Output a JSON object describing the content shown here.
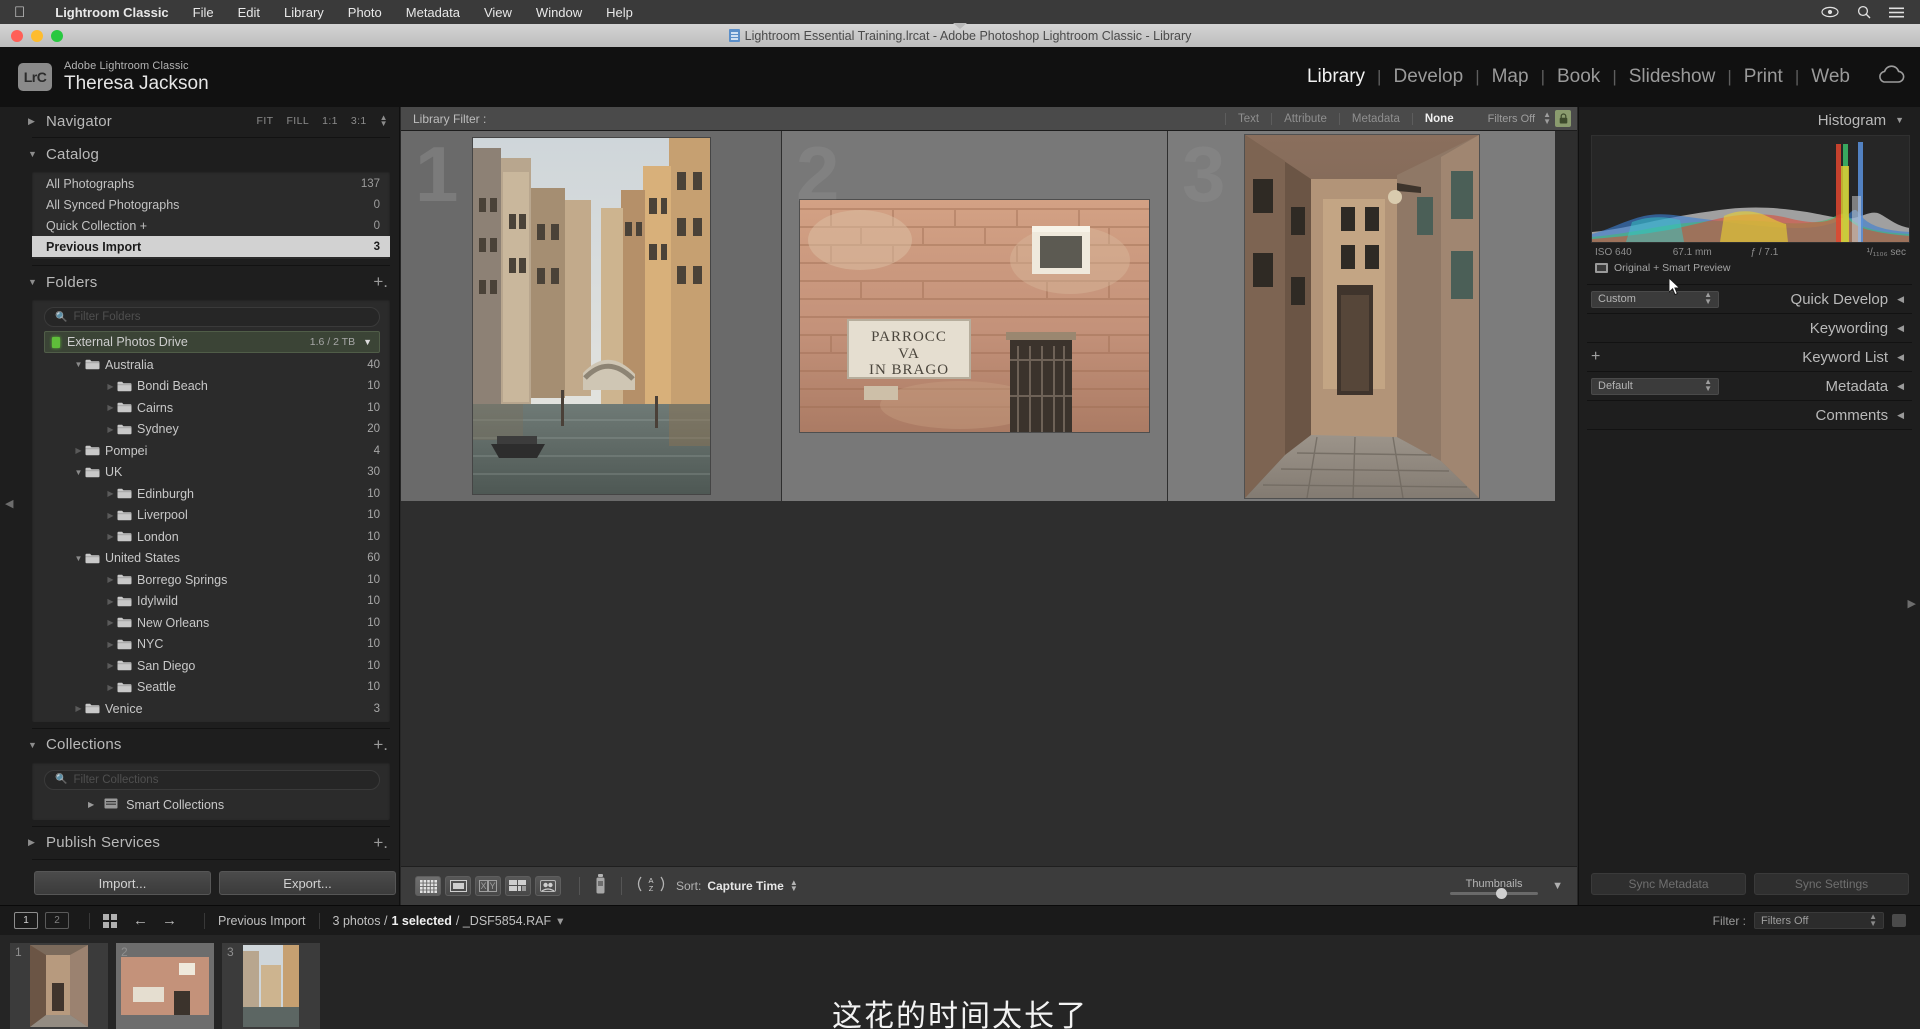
{
  "macmenu": {
    "apple_icon": "apple-icon",
    "items": [
      "Lightroom Classic",
      "File",
      "Edit",
      "Library",
      "Photo",
      "Metadata",
      "View",
      "Window",
      "Help"
    ],
    "right_icons": [
      "eye-icon",
      "search-icon",
      "control-center-icon"
    ]
  },
  "window": {
    "title": "Lightroom Essential Training.lrcat - Adobe Photoshop Lightroom Classic - Library",
    "doc_icon": "catalog-document-icon"
  },
  "identity": {
    "logo": "LrC",
    "product": "Adobe Lightroom Classic",
    "user": "Theresa Jackson",
    "cloud_icon": "cloud-sync-icon"
  },
  "modules": {
    "items": [
      "Library",
      "Develop",
      "Map",
      "Book",
      "Slideshow",
      "Print",
      "Web"
    ],
    "active": "Library",
    "separator": "|"
  },
  "navigator": {
    "title": "Navigator",
    "twisty": "▶",
    "zoom_options": [
      "FIT",
      "FILL",
      "1:1",
      "3:1"
    ],
    "stepper": "↕"
  },
  "catalog": {
    "title": "Catalog",
    "twisty": "▼",
    "items": [
      {
        "label": "All Photographs",
        "count": "137",
        "selected": false
      },
      {
        "label": "All Synced Photographs",
        "count": "0",
        "selected": false
      },
      {
        "label": "Quick Collection +",
        "count": "0",
        "selected": false
      },
      {
        "label": "Previous Import",
        "count": "3",
        "selected": true
      }
    ]
  },
  "folders": {
    "title": "Folders",
    "twisty": "▼",
    "add_icon": "plus-icon",
    "filter_placeholder": "Filter Folders",
    "drive": {
      "name": "External Photos Drive",
      "capacity": "1.6 / 2 TB",
      "led": "#5fbf3a"
    },
    "items": [
      {
        "label": "Australia",
        "count": "40",
        "level": 0,
        "expanded": true
      },
      {
        "label": "Bondi Beach",
        "count": "10",
        "level": 1,
        "expanded": false
      },
      {
        "label": "Cairns",
        "count": "10",
        "level": 1,
        "expanded": false
      },
      {
        "label": "Sydney",
        "count": "20",
        "level": 1,
        "expanded": false
      },
      {
        "label": "Pompei",
        "count": "4",
        "level": 0,
        "expanded": false
      },
      {
        "label": "UK",
        "count": "30",
        "level": 0,
        "expanded": true
      },
      {
        "label": "Edinburgh",
        "count": "10",
        "level": 1,
        "expanded": false
      },
      {
        "label": "Liverpool",
        "count": "10",
        "level": 1,
        "expanded": false
      },
      {
        "label": "London",
        "count": "10",
        "level": 1,
        "expanded": false
      },
      {
        "label": "United States",
        "count": "60",
        "level": 0,
        "expanded": true
      },
      {
        "label": "Borrego Springs",
        "count": "10",
        "level": 1,
        "expanded": false
      },
      {
        "label": "Idylwild",
        "count": "10",
        "level": 1,
        "expanded": false
      },
      {
        "label": "New Orleans",
        "count": "10",
        "level": 1,
        "expanded": false
      },
      {
        "label": "NYC",
        "count": "10",
        "level": 1,
        "expanded": false
      },
      {
        "label": "San Diego",
        "count": "10",
        "level": 1,
        "expanded": false
      },
      {
        "label": "Seattle",
        "count": "10",
        "level": 1,
        "expanded": false
      },
      {
        "label": "Venice",
        "count": "3",
        "level": 0,
        "expanded": false
      }
    ]
  },
  "collections": {
    "title": "Collections",
    "twisty": "▼",
    "add_icon": "plus-icon",
    "filter_placeholder": "Filter Collections",
    "items": [
      {
        "label": "Smart Collections",
        "twisty": "▶",
        "icon": "smart-collection-icon"
      }
    ]
  },
  "publish_services": {
    "title": "Publish Services",
    "twisty": "▶",
    "add_icon": "plus-icon"
  },
  "left_buttons": {
    "import": "Import...",
    "export": "Export..."
  },
  "library_filter": {
    "label": "Library Filter :",
    "options": [
      "Text",
      "Attribute",
      "Metadata",
      "None"
    ],
    "active": "None",
    "filters_off": "Filters Off",
    "stepper": "↕",
    "lock_icon": "lock-icon"
  },
  "grid": {
    "cells": [
      {
        "number": "1",
        "name": "venice-canal-photo",
        "selected": true
      },
      {
        "number": "2",
        "name": "brick-wall-sign-photo",
        "selected": false
      },
      {
        "number": "3",
        "name": "narrow-alley-photo",
        "selected": false
      }
    ]
  },
  "toolbar": {
    "view_buttons": [
      "grid-view-icon",
      "loupe-view-icon",
      "compare-view-icon",
      "survey-view-icon",
      "people-view-icon"
    ],
    "spray_icon": "spray-can-icon",
    "sort_direction_icon": "sort-az-icon",
    "sort_label": "Sort:",
    "sort_value": "Capture Time",
    "sort_stepper": "↕",
    "thumbnails_label": "Thumbnails",
    "collapse_icon": "chevron-down-icon"
  },
  "histogram": {
    "title": "Histogram",
    "caret": "▼",
    "iso": "ISO 640",
    "focal": "67.1 mm",
    "aperture": "ƒ / 7.1",
    "shutter": "¹/₁₁₀₆ sec",
    "preview_status": "Original + Smart Preview",
    "preview_icon": "smart-preview-icon"
  },
  "right_panels": [
    {
      "label": "Quick Develop",
      "caret": "◀",
      "select": "Custom",
      "has_select": true,
      "has_plus": false
    },
    {
      "label": "Keywording",
      "caret": "◀",
      "select": "",
      "has_select": false,
      "has_plus": false
    },
    {
      "label": "Keyword List",
      "caret": "◀",
      "select": "",
      "has_select": false,
      "has_plus": true
    },
    {
      "label": "Metadata",
      "caret": "◀",
      "select": "Default",
      "has_select": true,
      "has_plus": false
    },
    {
      "label": "Comments",
      "caret": "◀",
      "select": "",
      "has_select": false,
      "has_plus": false
    }
  ],
  "sync_buttons": {
    "metadata": "Sync Metadata",
    "settings": "Sync Settings"
  },
  "filmstrip_bar": {
    "screen1": "1",
    "screen2": "2",
    "grid_icon": "grid-icon",
    "back_arrow": "←",
    "forward_arrow": "→",
    "source": "Previous Import",
    "photo_count": "3 photos /",
    "selected_count": "1 selected",
    "filename": "/ _DSF5854.RAF",
    "dropdown": "▾",
    "filter_label": "Filter :",
    "filter_value": "Filters Off",
    "stepper": "↕"
  },
  "filmstrip": {
    "thumbs": [
      {
        "number": "1",
        "name": "filmstrip-thumb-1",
        "selected": false
      },
      {
        "number": "2",
        "name": "filmstrip-thumb-2",
        "selected": true
      },
      {
        "number": "3",
        "name": "filmstrip-thumb-3",
        "selected": false
      }
    ]
  },
  "overlay": {
    "subtitle": "这花的时间太长了"
  },
  "colors": {
    "panel_bg": "#1e1e1e",
    "grid_bg": "#2e2e2e",
    "selection": "#d2d2d2",
    "drive_green": "#5fbf3a",
    "accent_text": "#f2f2f2"
  }
}
